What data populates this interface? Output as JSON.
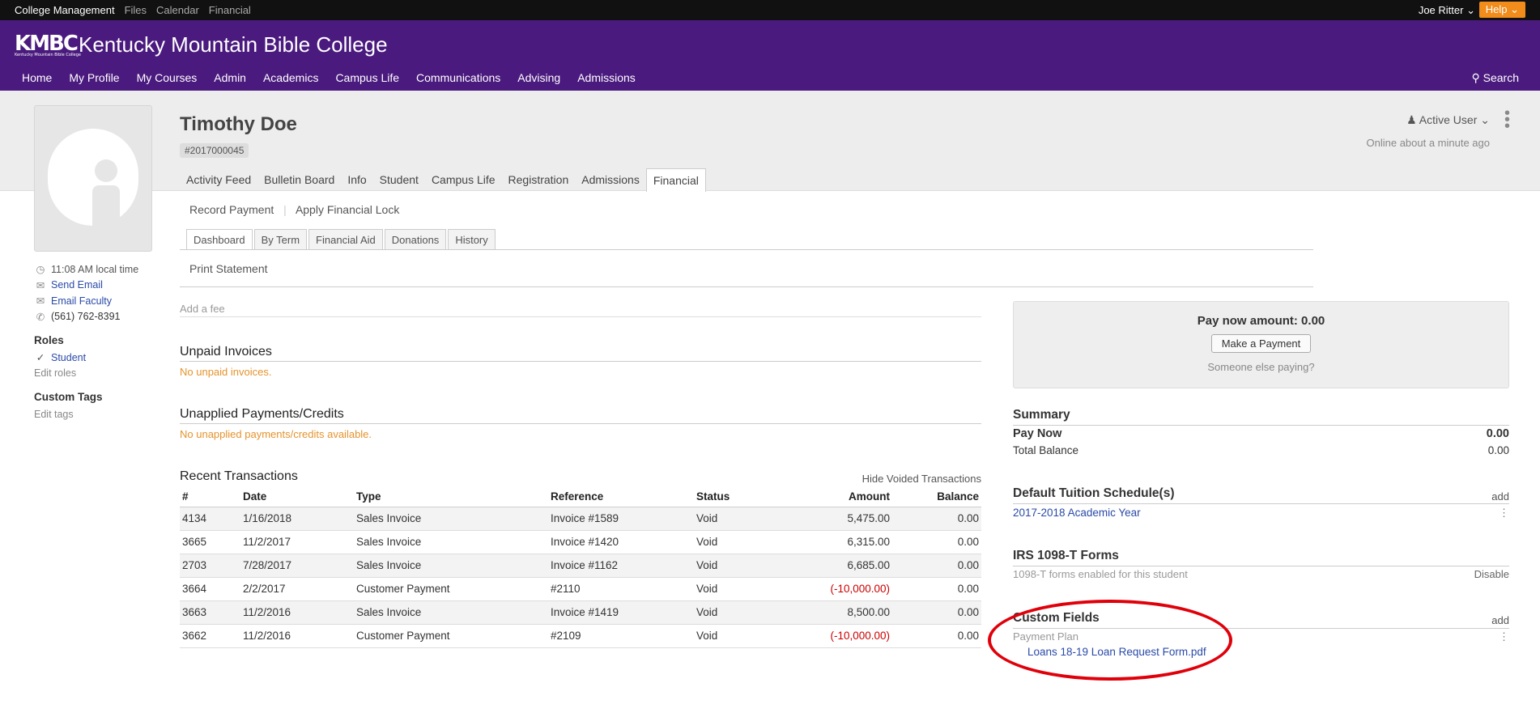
{
  "topbar": {
    "items": [
      "College Management",
      "Files",
      "Calendar",
      "Financial"
    ],
    "user": "Joe Ritter",
    "help": "Help"
  },
  "header": {
    "logo_text": "KMBC",
    "logo_small": "Kentucky Mountain Bible College",
    "college_name": "Kentucky Mountain Bible College",
    "nav": [
      "Home",
      "My Profile",
      "My Courses",
      "Admin",
      "Academics",
      "Campus Life",
      "Communications",
      "Advising",
      "Admissions"
    ],
    "search": "Search"
  },
  "profile": {
    "name": "Timothy Doe",
    "id": "#2017000045",
    "status": "Active User",
    "online": "Online about a minute ago",
    "tabs": [
      "Activity Feed",
      "Bulletin Board",
      "Info",
      "Student",
      "Campus Life",
      "Registration",
      "Admissions",
      "Financial"
    ],
    "active_tab": "Financial"
  },
  "left": {
    "local_time": "11:08 AM local time",
    "send_email": "Send Email",
    "email_faculty": "Email Faculty",
    "phone": "(561) 762-8391",
    "roles_title": "Roles",
    "role": "Student",
    "edit_roles": "Edit roles",
    "tags_title": "Custom Tags",
    "edit_tags": "Edit tags"
  },
  "financial": {
    "actions": [
      "Record Payment",
      "Apply Financial Lock"
    ],
    "subtabs": [
      "Dashboard",
      "By Term",
      "Financial Aid",
      "Donations",
      "History"
    ],
    "print": "Print Statement",
    "add_fee": "Add a fee",
    "unpaid_title": "Unpaid Invoices",
    "unpaid_empty": "No unpaid invoices.",
    "unapplied_title": "Unapplied Payments/Credits",
    "unapplied_empty": "No unapplied payments/credits available.",
    "recent_title": "Recent Transactions",
    "hide_voided": "Hide Voided Transactions",
    "columns": [
      "#",
      "Date",
      "Type",
      "Reference",
      "Status",
      "Amount",
      "Balance"
    ],
    "rows": [
      {
        "num": "4134",
        "date": "1/16/2018",
        "type": "Sales Invoice",
        "ref": "Invoice #1589",
        "status": "Void",
        "amount": "5,475.00",
        "balance": "0.00",
        "neg": false
      },
      {
        "num": "3665",
        "date": "11/2/2017",
        "type": "Sales Invoice",
        "ref": "Invoice #1420",
        "status": "Void",
        "amount": "6,315.00",
        "balance": "0.00",
        "neg": false
      },
      {
        "num": "2703",
        "date": "7/28/2017",
        "type": "Sales Invoice",
        "ref": "Invoice #1162",
        "status": "Void",
        "amount": "6,685.00",
        "balance": "0.00",
        "neg": false
      },
      {
        "num": "3664",
        "date": "2/2/2017",
        "type": "Customer Payment",
        "ref": "#2110",
        "status": "Void",
        "amount": "(-10,000.00)",
        "balance": "0.00",
        "neg": true
      },
      {
        "num": "3663",
        "date": "11/2/2016",
        "type": "Sales Invoice",
        "ref": "Invoice #1419",
        "status": "Void",
        "amount": "8,500.00",
        "balance": "0.00",
        "neg": false
      },
      {
        "num": "3662",
        "date": "11/2/2016",
        "type": "Customer Payment",
        "ref": "#2109",
        "status": "Void",
        "amount": "(-10,000.00)",
        "balance": "0.00",
        "neg": true
      }
    ]
  },
  "right": {
    "pay_now_amount": "Pay now amount: 0.00",
    "make_payment": "Make a Payment",
    "someone_else": "Someone else paying?",
    "summary_title": "Summary",
    "pay_now_label": "Pay Now",
    "pay_now_value": "0.00",
    "total_label": "Total Balance",
    "total_value": "0.00",
    "tuition_title": "Default Tuition Schedule(s)",
    "add": "add",
    "tuition_item": "2017-2018 Academic Year",
    "irs_title": "IRS 1098-T Forms",
    "irs_text": "1098-T forms enabled for this student",
    "disable": "Disable",
    "custom_title": "Custom Fields",
    "custom_label": "Payment Plan",
    "custom_file": "Loans 18-19 Loan Request Form.pdf"
  },
  "colors": {
    "header_purple": "#4a1a7e",
    "help_orange": "#f28c1b",
    "link_blue": "#2a4aa8",
    "empty_orange": "#e5932c",
    "negative_red": "#cc0000",
    "annotation_red": "#e0000a"
  }
}
